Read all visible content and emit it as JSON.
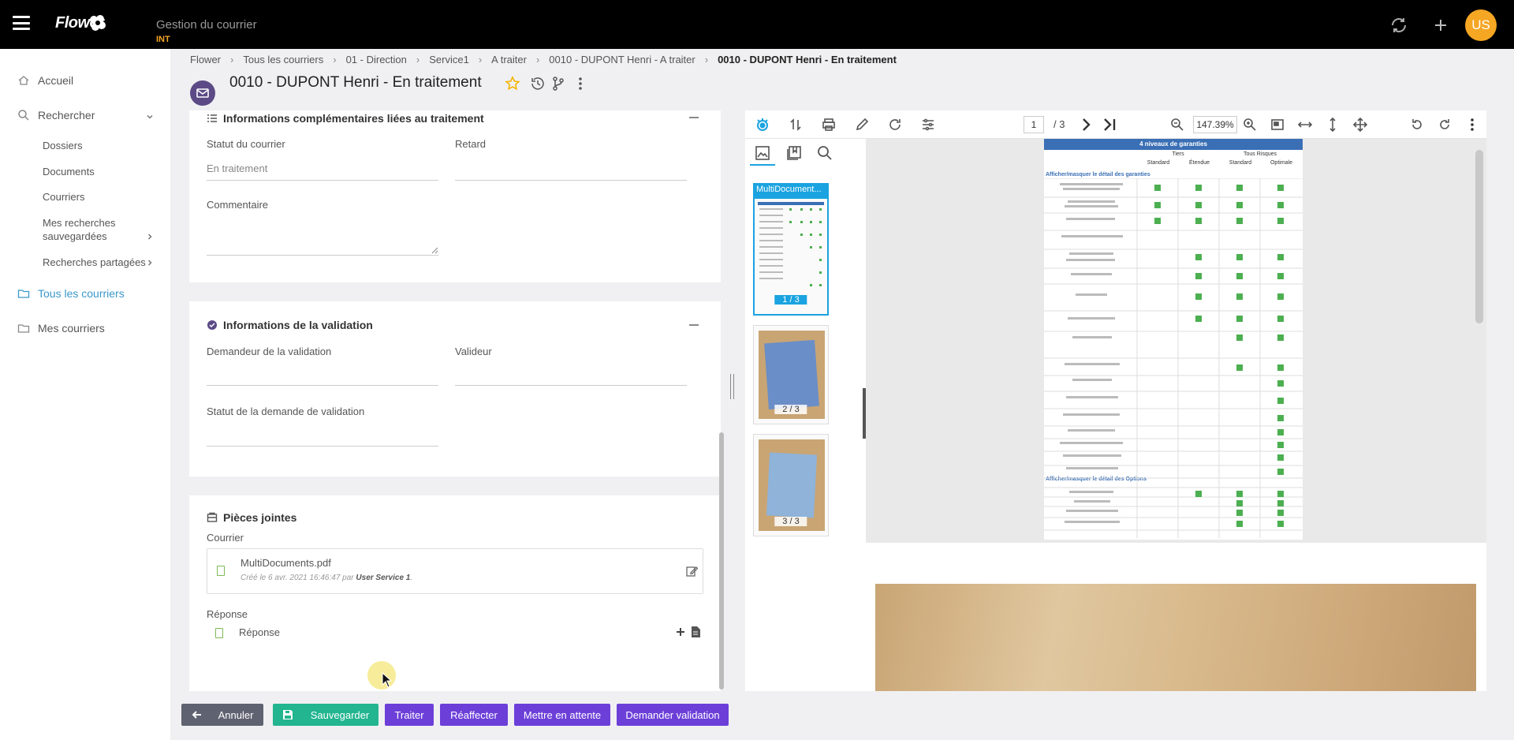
{
  "app": {
    "logo": "Flower",
    "title": "Gestion du courrier",
    "env": "INT",
    "user_initials": "US"
  },
  "sidebar": {
    "items": [
      {
        "label": "Accueil"
      },
      {
        "label": "Rechercher"
      },
      {
        "label": "Dossiers"
      },
      {
        "label": "Documents"
      },
      {
        "label": "Courriers"
      },
      {
        "label": "Mes recherches sauvegardées"
      },
      {
        "label": "Recherches partagées"
      },
      {
        "label": "Tous les courriers"
      },
      {
        "label": "Mes courriers"
      }
    ]
  },
  "breadcrumb": [
    "Flower",
    "Tous les courriers",
    "01 - Direction",
    "Service1",
    "A traiter",
    "0010 - DUPONT Henri - A traiter",
    "0010 - DUPONT Henri - En traitement"
  ],
  "header": {
    "title": "0010 - DUPONT Henri - En traitement"
  },
  "sections": {
    "traitement": {
      "title": "Informations complémentaires liées au traitement",
      "statut_label": "Statut du courrier",
      "statut_value": "En traitement",
      "retard_label": "Retard",
      "commentaire_label": "Commentaire"
    },
    "validation": {
      "title": "Informations de la validation",
      "demandeur_label": "Demandeur de la validation",
      "valideur_label": "Valideur",
      "statut_label": "Statut de la demande de validation"
    },
    "pieces": {
      "title": "Pièces jointes",
      "courrier_label": "Courrier",
      "file_name": "MultiDocuments.pdf",
      "file_meta_prefix": "Créé le 6 avr. 2021 16:46:47 par",
      "file_meta_user": "User Service 1",
      "file_meta_suffix": ".",
      "reponse_label": "Réponse",
      "reponse_item": "Réponse"
    }
  },
  "viewer": {
    "current_page": "1",
    "page_total": "/ 3",
    "zoom": "147.39%",
    "thumb_title": "MultiDocument...",
    "thumbs": [
      "1 / 3",
      "2 / 3",
      "3 / 3"
    ],
    "table_header": "4 niveaux de garanties",
    "col_groups": [
      "Tiers",
      "Tous Risques"
    ],
    "cols": [
      "Standard",
      "Étendue",
      "Standard",
      "Optimale"
    ],
    "section_garanties": "Afficher/masquer le détail des garanties",
    "section_options": "Afficher/masquer le détail des Options"
  },
  "actions": {
    "annuler": "Annuler",
    "sauvegarder": "Sauvegarder",
    "traiter": "Traiter",
    "reaffecter": "Réaffecter",
    "attente": "Mettre en attente",
    "validation": "Demander validation"
  },
  "colors": {
    "accent": "#3a98c9",
    "purple": "#6c3fd8",
    "green": "#22b58f",
    "orange": "#f5a623"
  }
}
